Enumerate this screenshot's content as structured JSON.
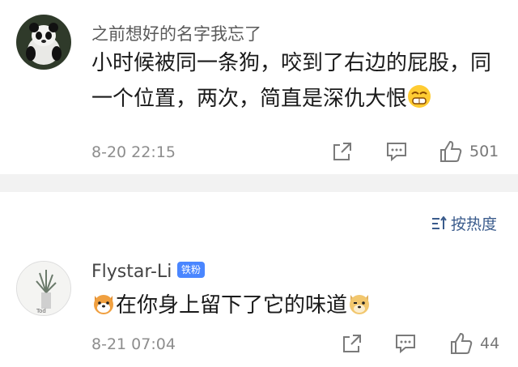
{
  "comments": [
    {
      "username": "之前想好的名字我忘了",
      "text_line1": "小时候被同一条狗，咬到了右边的屁股，同",
      "text_line2": "一个位置，两次，简直是深仇大恨",
      "time": "8-20 22:15",
      "likes": "501",
      "emoji_end": "grin-sweat-emoji"
    },
    {
      "username": "Flystar-Li",
      "badge": "铁粉",
      "text": "在你身上留下了它的味道",
      "time": "8-21 07:04",
      "likes": "44",
      "emoji_start": "shiba-dog-emoji",
      "emoji_end": "doge-emoji"
    }
  ],
  "sort": {
    "label": "按热度",
    "icon": "sort-icon"
  },
  "colors": {
    "link": "#3a5b8c",
    "badge": "#4a86ff",
    "divider": "#f2f2f2"
  }
}
